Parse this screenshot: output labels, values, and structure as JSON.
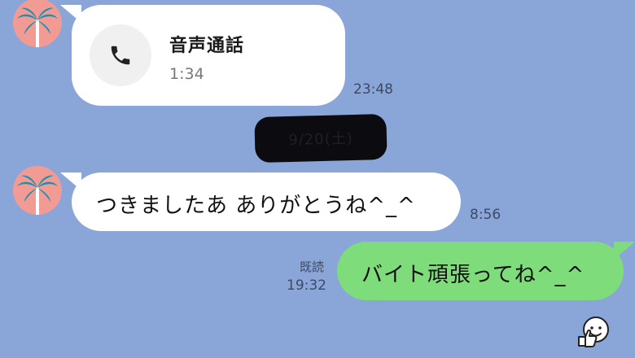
{
  "messages": [
    {
      "type": "voice-call",
      "title": "音声通話",
      "duration": "1:34",
      "time": "23:48",
      "icon": "phone-icon"
    },
    {
      "type": "date-separator",
      "label": "9/20(土)"
    },
    {
      "type": "text",
      "text": "つきましたあ ありがとうね^_^",
      "time": "8:56"
    },
    {
      "type": "outgoing-text",
      "text": "バイト頑張ってね^_^",
      "read_label": "既読",
      "time": "19:32"
    }
  ],
  "reaction_icon": "thumbs-up-face-sticker-icon",
  "avatar_icon": "palm-tree-avatar-icon",
  "colors": {
    "background": "#8aa5d7",
    "incoming_bubble": "#ffffff",
    "outgoing_bubble": "#7fdc7a",
    "avatar": "#f29a94",
    "palm": "#1f8fae"
  }
}
